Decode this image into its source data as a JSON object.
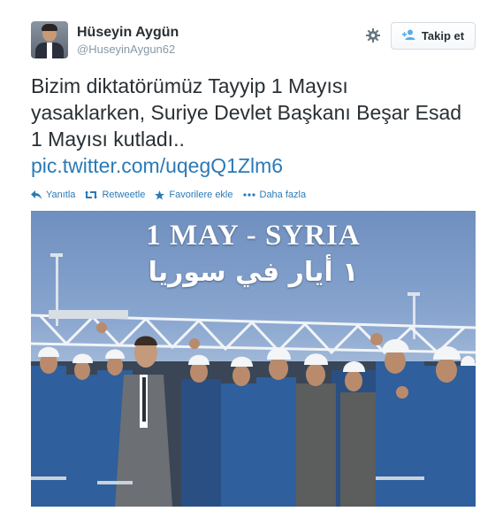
{
  "user": {
    "full_name": "Hüseyin Aygün",
    "username": "@HuseyinAygun62"
  },
  "header": {
    "gear_icon": "gear-icon",
    "follow_label": "Takip et"
  },
  "tweet": {
    "text": "Bizim diktatörümüz Tayyip 1 Mayısı yasaklarken, Suriye Devlet Başkanı Beşar Esad 1 Mayısı kutladı..",
    "link": "pic.twitter.com/uqegQ1Zlm6"
  },
  "actions": [
    {
      "label": "Yanıtla",
      "icon": "reply-icon"
    },
    {
      "label": "Retweetle",
      "icon": "retweet-icon"
    },
    {
      "label": "Favorilere ekle",
      "icon": "star-icon"
    },
    {
      "label": "Daha fazla",
      "icon": "more-icon"
    }
  ],
  "photo": {
    "title": "1 MAY - SYRIA",
    "arabic": "١ أيار في سوريا"
  },
  "colors": {
    "link": "#2a7ab8",
    "text": "#292f33",
    "muted": "#8899a6"
  }
}
